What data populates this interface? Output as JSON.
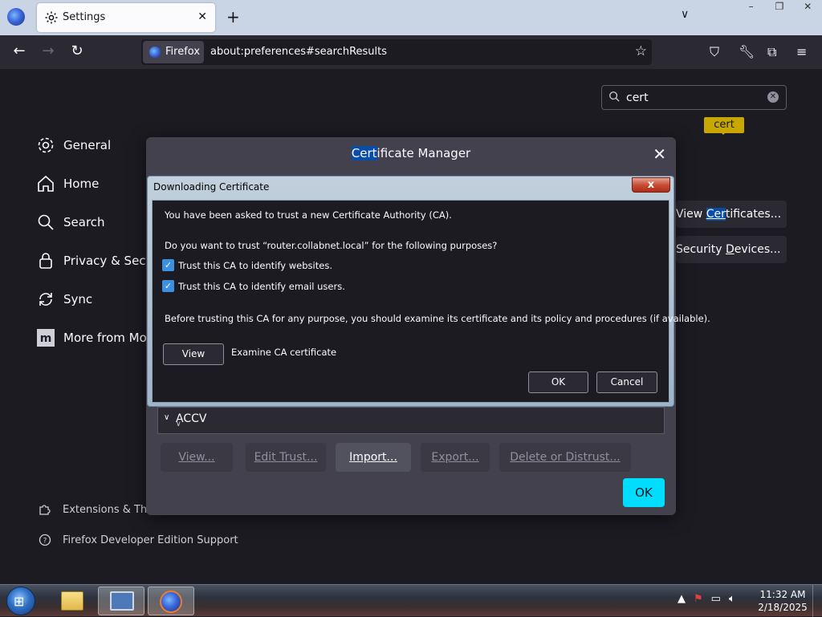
{
  "browser": {
    "tab_title": "Settings",
    "identity_label": "Firefox",
    "url": "about:preferences#searchResults"
  },
  "settings": {
    "search_value": "cert",
    "categories": [
      {
        "label": "General",
        "icon": "gear-icon"
      },
      {
        "label": "Home",
        "icon": "home-icon"
      },
      {
        "label": "Search",
        "icon": "search-icon"
      },
      {
        "label": "Privacy & Secu",
        "icon": "lock-icon"
      },
      {
        "label": "Sync",
        "icon": "sync-icon"
      },
      {
        "label": "More from Mo",
        "icon": "mozilla-icon"
      }
    ],
    "footer": {
      "extensions": "Extensions & The",
      "support": "Firefox Developer Edition Support"
    },
    "right_buttons": {
      "view_certificates_pre": "View ",
      "view_certificates_hl": "Cer",
      "view_certificates_post": "tificates...",
      "security_devices_pre": "Security ",
      "security_devices_u": "D",
      "security_devices_post": "evices..."
    },
    "highlight_tooltip": "cert"
  },
  "certificate_manager": {
    "title_highlight": "Cert",
    "title_rest": "ificate Manager",
    "list_item": "ACCV",
    "buttons": {
      "view": "View...",
      "edit_trust": "Edit Trust...",
      "import": "Import...",
      "export": "Export...",
      "delete": "Delete or Distrust..."
    },
    "ok": "OK"
  },
  "download_dialog": {
    "title": "Downloading Certificate",
    "intro": "You have been asked to trust a new Certificate Authority (CA).",
    "question": "Do you want to trust “router.collabnet.local” for the following purposes?",
    "checkboxes": [
      {
        "label": "Trust this CA to identify websites.",
        "checked": true
      },
      {
        "label": "Trust this CA to identify email users.",
        "checked": true
      }
    ],
    "advice": "Before trusting this CA for any purpose, you should examine its certificate and its policy and procedures (if available).",
    "view_button": "View",
    "view_desc": "Examine CA certificate",
    "ok": "OK",
    "cancel": "Cancel",
    "close_glyph": "x"
  },
  "taskbar": {
    "time": "11:32 AM",
    "date": "2/18/2025"
  }
}
